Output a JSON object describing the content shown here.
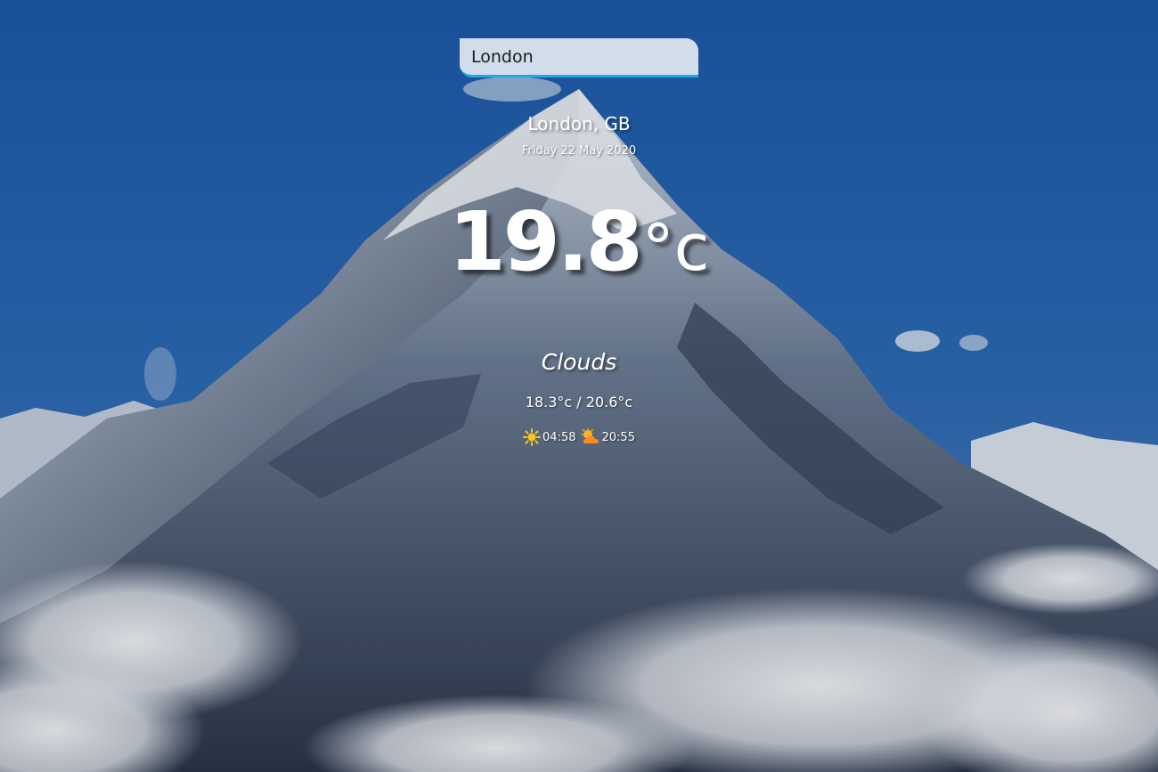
{
  "search": {
    "value": "London",
    "placeholder": ""
  },
  "location": {
    "label": "London, GB",
    "date": "Friday 22 May 2020"
  },
  "temperature": {
    "value": "19.8",
    "unit": "°c"
  },
  "weather": {
    "description": "Clouds",
    "min_max": "18.3°c / 20.6°c"
  },
  "sun": {
    "sunrise": "04:58",
    "sunset": "20:55",
    "sunrise_icon": "sun-icon",
    "sunset_icon": "sun-behind-cloud-icon"
  },
  "colors": {
    "accent": "#1fa9e6",
    "text": "#ffffff",
    "sun_icon": "#ffc61a",
    "sunset_icon": "#ff8a1f"
  }
}
